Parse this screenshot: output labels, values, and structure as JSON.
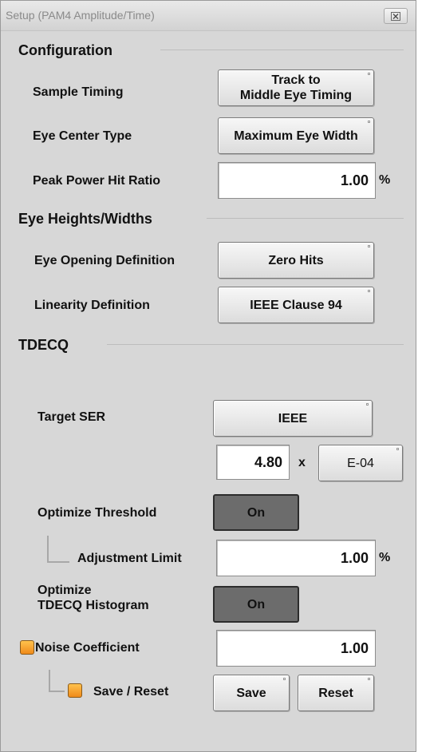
{
  "window": {
    "title": "Setup (PAM4 Amplitude/Time)",
    "close_icon": "close-icon"
  },
  "configuration": {
    "heading": "Configuration",
    "sample_timing_label": "Sample Timing",
    "sample_timing_value_line1": "Track to",
    "sample_timing_value_line2": "Middle Eye Timing",
    "eye_center_label": "Eye Center Type",
    "eye_center_value": "Maximum Eye Width",
    "peak_power_label": "Peak Power Hit Ratio",
    "peak_power_value": "1.00",
    "peak_power_unit": "%"
  },
  "eye_heights": {
    "heading": "Eye Heights/Widths",
    "eye_opening_label": "Eye Opening Definition",
    "eye_opening_value": "Zero Hits",
    "linearity_label": "Linearity Definition",
    "linearity_value": "IEEE Clause 94"
  },
  "tdecq": {
    "heading": "TDECQ",
    "target_ser_label": "Target SER",
    "target_ser_value": "IEEE",
    "ser_mantissa": "4.80",
    "ser_times": "x",
    "ser_exponent": "E-04",
    "optimize_threshold_label": "Optimize Threshold",
    "optimize_threshold_value": "On",
    "adjustment_limit_label": "Adjustment Limit",
    "adjustment_limit_value": "1.00",
    "adjustment_limit_unit": "%",
    "optimize_histogram_label_line1": "Optimize",
    "optimize_histogram_label_line2": "TDECQ Histogram",
    "optimize_histogram_value": "On",
    "noise_coefficient_label": "Noise Coefficient",
    "noise_coefficient_value": "1.00",
    "save_reset_label": "Save / Reset",
    "save_button": "Save",
    "reset_button": "Reset"
  },
  "colors": {
    "panel_bg": "#d7d7d7",
    "checkbox_orange": "#f5a02a",
    "on_button_bg": "#6c6c6c"
  }
}
